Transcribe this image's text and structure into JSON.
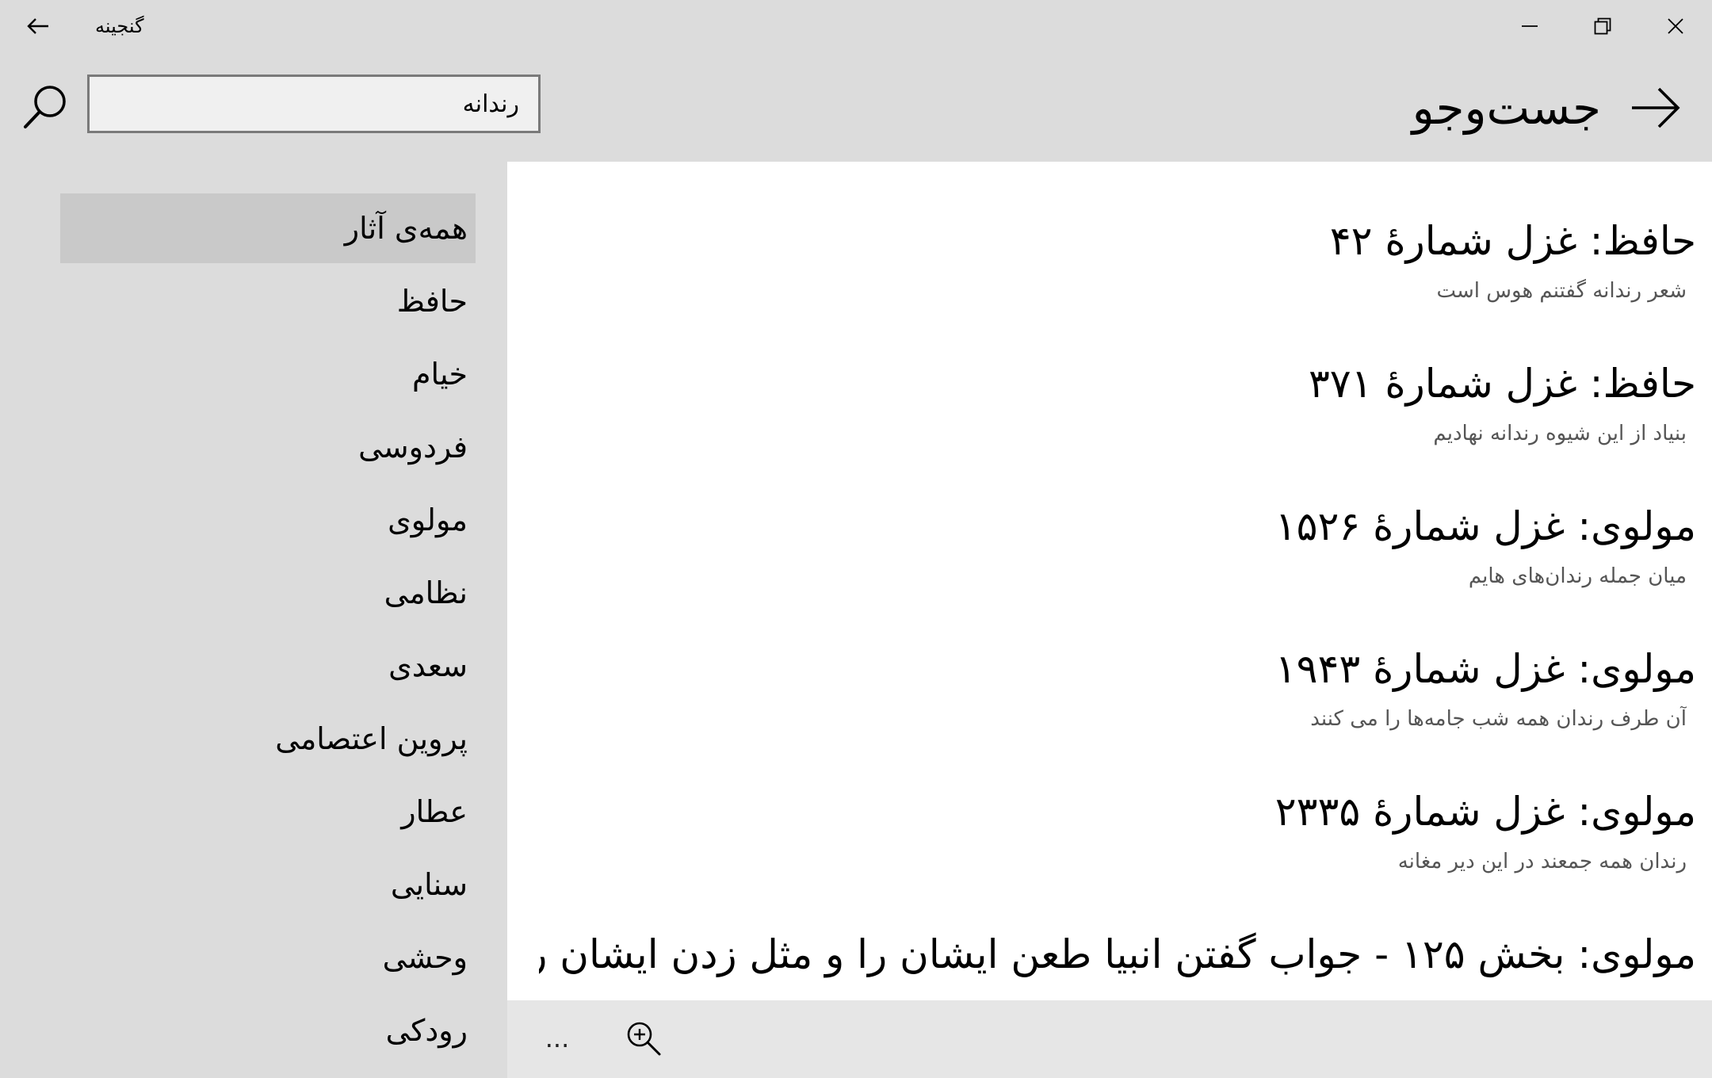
{
  "app": {
    "title": "گنجینه"
  },
  "header": {
    "page_title": "جست‌وجو",
    "search_value": "رندانه"
  },
  "sidebar": {
    "items": [
      {
        "label": "همه‌ی آثار",
        "selected": true
      },
      {
        "label": "حافظ"
      },
      {
        "label": "خیام"
      },
      {
        "label": "فردوسی"
      },
      {
        "label": "مولوی"
      },
      {
        "label": "نظامی"
      },
      {
        "label": "سعدی"
      },
      {
        "label": "پروین اعتصامی"
      },
      {
        "label": "عطار"
      },
      {
        "label": "سنایی"
      },
      {
        "label": "وحشی"
      },
      {
        "label": "رودکی"
      }
    ]
  },
  "results": [
    {
      "title": "حافظ: غزل شمارهٔ ۴۲",
      "excerpt": "شعر رندانه گفتنم هوس است"
    },
    {
      "title": "حافظ: غزل شمارهٔ ۳۷۱",
      "excerpt": "بنیاد از این شیوه رندانه نهادیم"
    },
    {
      "title": "مولوی: غزل شمارهٔ ۱۵۲۶",
      "excerpt": "میان جمله رندان‌های هایم"
    },
    {
      "title": "مولوی: غزل شمارهٔ ۱۹۴۳",
      "excerpt": "آن طرف رندان همه شب جامه‌ها را می کنند"
    },
    {
      "title": "مولوی: غزل شمارهٔ ۲۳۳۵",
      "excerpt": "رندان همه جمعند در این دیر مغانه"
    },
    {
      "title": "مولوی: بخش ۱۲۵ - جواب گفتن انبیا طعن ایشان را و  مثل زدن ایشان ر",
      "excerpt": ""
    }
  ],
  "bottombar": {
    "more_label": "..."
  },
  "icons": {
    "back": "arrow-left-icon",
    "forward": "arrow-right-icon",
    "search": "search-icon",
    "zoom": "zoom-in-icon",
    "minimize": "minimize-icon",
    "maximize": "restore-icon",
    "close": "close-icon"
  },
  "colors": {
    "chrome": "#dcdcdc",
    "selected_item": "#c9c9c9",
    "content_bg": "#ffffff",
    "bottombar": "#e6e6e6",
    "excerpt_text": "#555555"
  }
}
